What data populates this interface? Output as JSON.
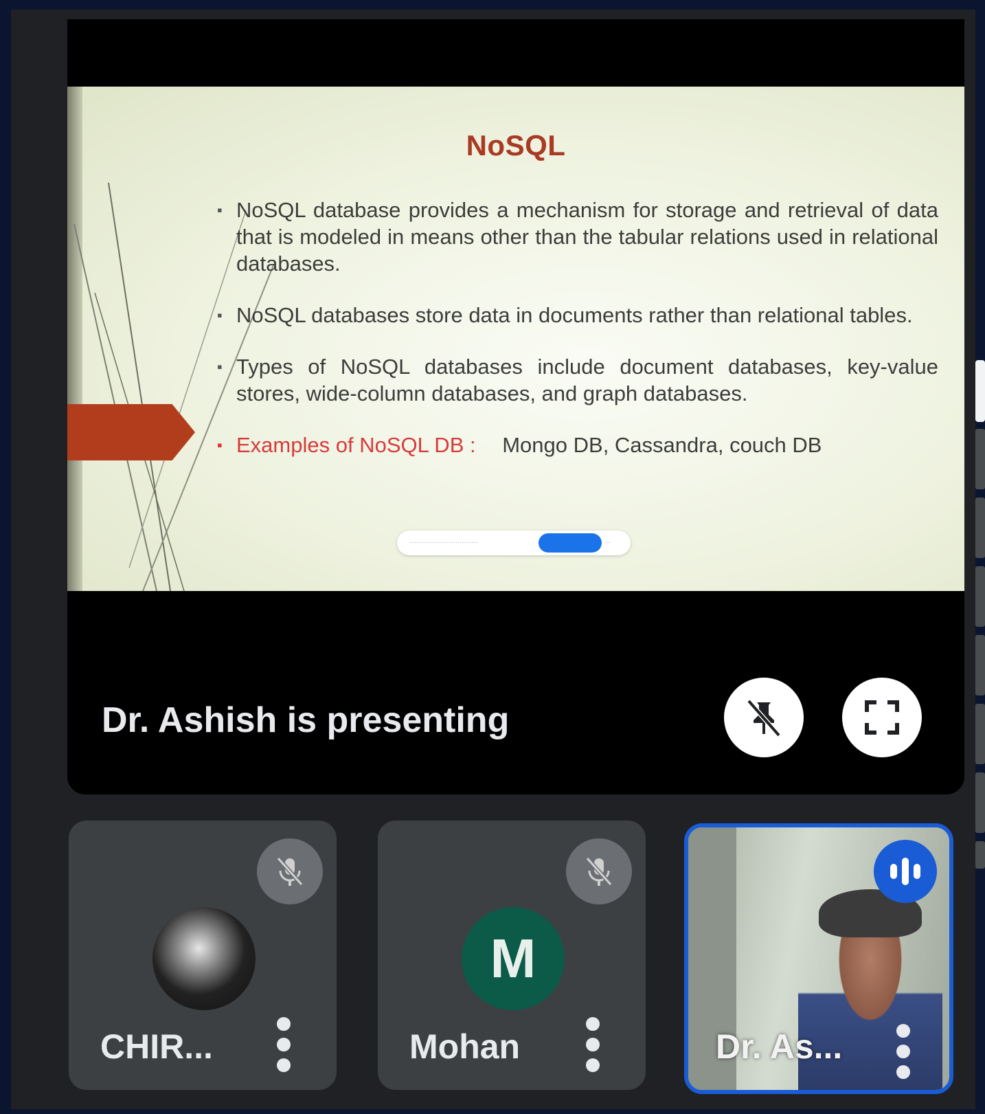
{
  "slide": {
    "title": "NoSQL",
    "bullets": [
      "NoSQL database provides a mechanism for storage and retrieval of data that is modeled in means other than the tabular relations used in relational databases.",
      "NoSQL databases store data in documents rather than relational tables.",
      "Types of NoSQL databases include document databases, key-value stores, wide-column databases, and graph databases."
    ],
    "examples_label": "Examples of NoSQL DB :",
    "examples_value": "Mongo DB, Cassandra, couch DB"
  },
  "presentation": {
    "presenting_text": "Dr. Ashish is presenting"
  },
  "participants": [
    {
      "name": "CHIR...",
      "muted": true,
      "avatar": "photo"
    },
    {
      "name": "Mohan",
      "muted": true,
      "avatar_letter": "M",
      "avatar_color": "#0b5b48"
    },
    {
      "name": "Dr. As...",
      "speaking": true,
      "avatar": "video"
    }
  ],
  "colors": {
    "page_bg": "#0c1530",
    "panel_bg": "#202124",
    "tile_bg": "#3c4043",
    "accent_blue": "#1a5bd6",
    "slide_title": "#a93a24"
  },
  "icons": {
    "pin": "pin-off-icon",
    "fullscreen": "fullscreen-icon",
    "mic_off": "mic-off-icon",
    "more": "more-vert-icon",
    "speaking": "audio-level-icon"
  }
}
